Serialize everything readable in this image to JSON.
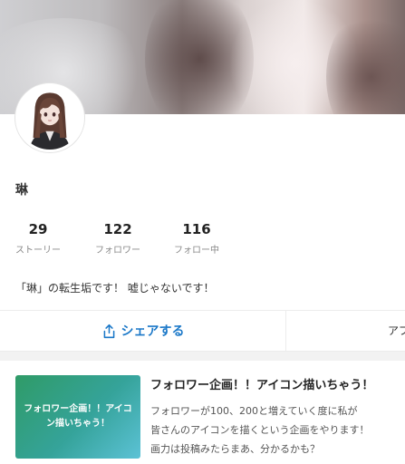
{
  "profile": {
    "username": "琳",
    "bio": "「琳」の転生垢です！ 嘘じゃないです！"
  },
  "stats": [
    {
      "value": "29",
      "label": "ストーリー"
    },
    {
      "value": "122",
      "label": "フォロワー"
    },
    {
      "value": "116",
      "label": "フォロー中"
    }
  ],
  "actions": {
    "share_label": "シェアする",
    "app_label": "アプ"
  },
  "post": {
    "thumb_text": "フォロワー企画！！アイコン描いちゃう！",
    "title": "フォロワー企画！！アイコン描いちゃう！",
    "body_lines": [
      "フォロワーが100、200と増えていく度に私が",
      "皆さんのアイコンを描くという企画をやります！",
      "画力は投稿みたらまあ、分かるかも？"
    ]
  },
  "colors": {
    "accent": "#1b78c8",
    "thumb_start": "#2f9b67",
    "thumb_end": "#5cc2d6"
  },
  "icons": {
    "share": "share-icon"
  }
}
